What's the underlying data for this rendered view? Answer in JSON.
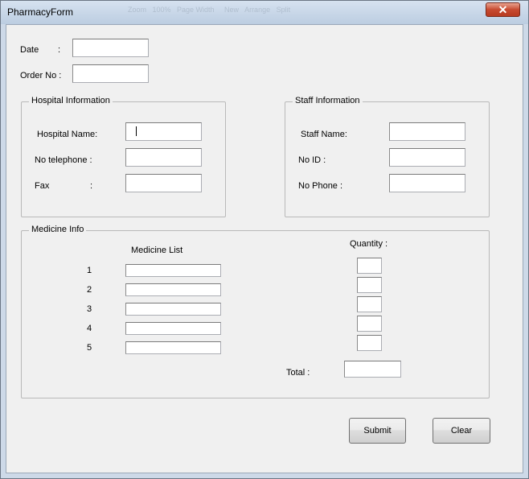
{
  "window": {
    "title": "PharmacyForm",
    "close_glyph": "✕"
  },
  "form": {
    "date_label": "Date",
    "date_colon": ":",
    "date_value": "",
    "order_label": "Order No :",
    "order_value": ""
  },
  "hospital": {
    "caption": "Hospital Information",
    "name_label": "Hospital Name:",
    "name_value": "",
    "phone_label": "No telephone  :",
    "phone_value": "",
    "fax_label": "Fax",
    "fax_colon": ":",
    "fax_value": ""
  },
  "staff": {
    "caption": "Staff Information",
    "name_label": "Staff Name:",
    "name_value": "",
    "id_label": "No ID  :",
    "id_value": "",
    "phone_label": "No Phone :",
    "phone_value": ""
  },
  "medicine": {
    "caption": "Medicine Info",
    "list_header": "Medicine List",
    "quantity_header": "Quantity :",
    "rows": [
      {
        "num": "1",
        "name": "",
        "qty": ""
      },
      {
        "num": "2",
        "name": "",
        "qty": ""
      },
      {
        "num": "3",
        "name": "",
        "qty": ""
      },
      {
        "num": "4",
        "name": "",
        "qty": ""
      },
      {
        "num": "5",
        "name": "",
        "qty": ""
      }
    ],
    "total_label": "Total :",
    "total_value": ""
  },
  "buttons": {
    "submit": "Submit",
    "clear": "Clear"
  }
}
